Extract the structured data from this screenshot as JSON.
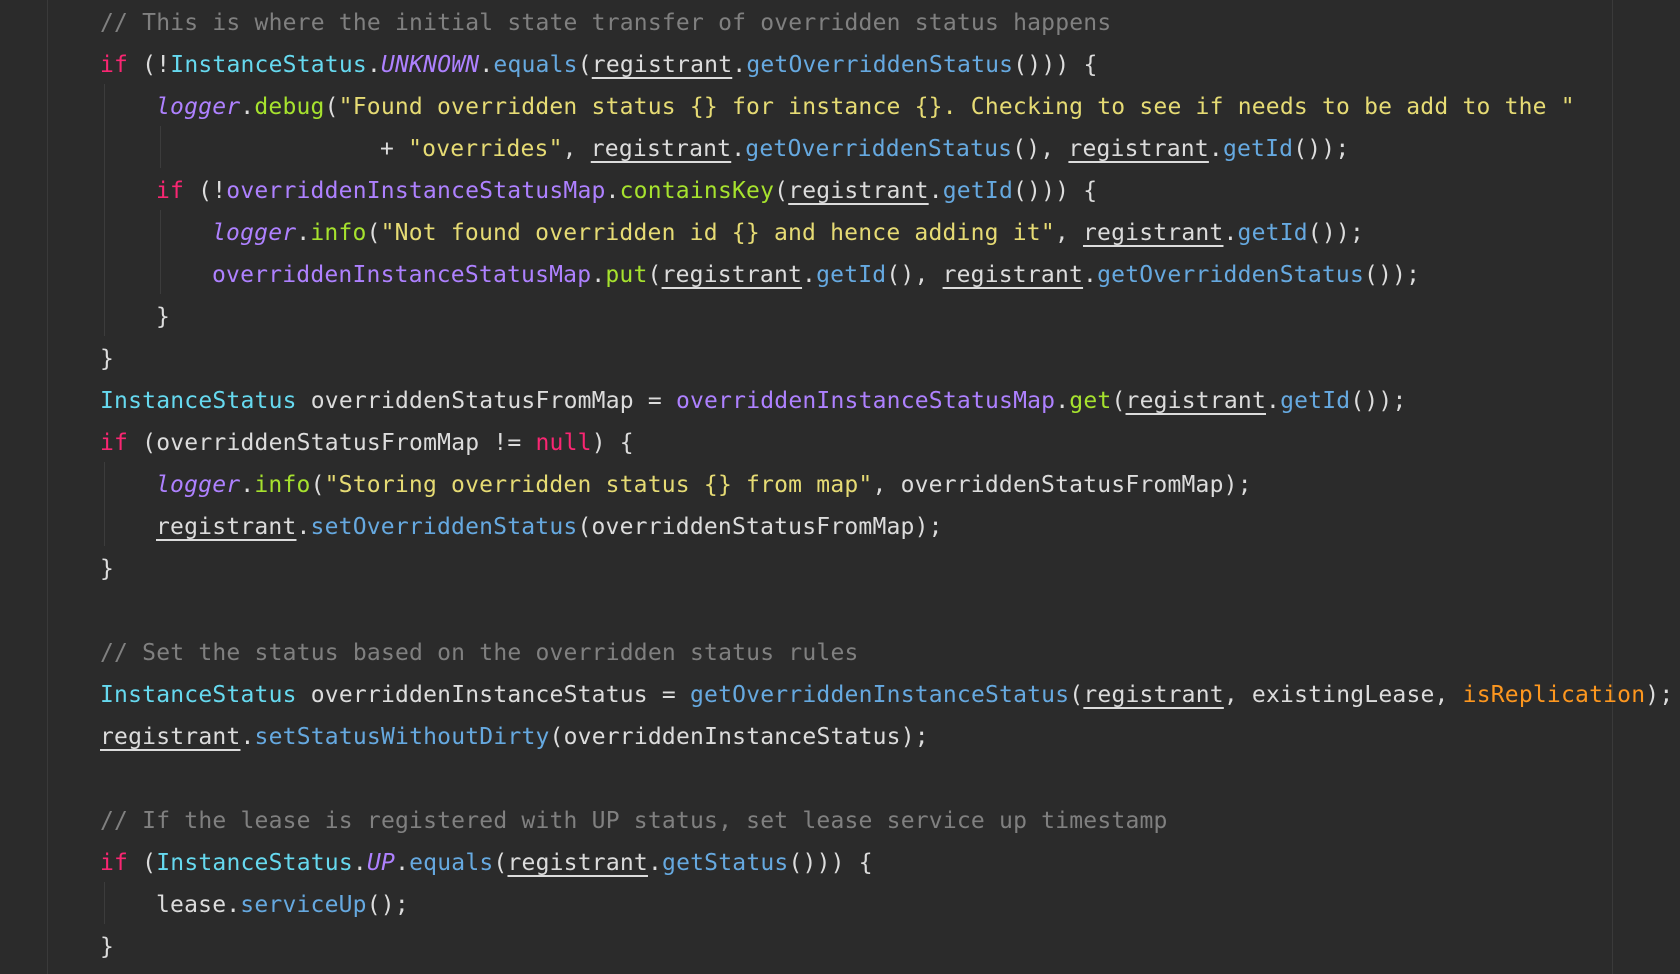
{
  "editor": {
    "lines": [
      [
        {
          "t": "// This is where the initial state transfer of overridden status happens",
          "c": "comment"
        }
      ],
      [
        {
          "t": "if",
          "c": "keyword"
        },
        {
          "t": " (!",
          "c": "plain"
        },
        {
          "t": "InstanceStatus",
          "c": "type"
        },
        {
          "t": ".",
          "c": "plain"
        },
        {
          "t": "UNKNOWN",
          "c": "const"
        },
        {
          "t": ".",
          "c": "plain"
        },
        {
          "t": "equals",
          "c": "method"
        },
        {
          "t": "(",
          "c": "plain"
        },
        {
          "t": "registrant",
          "c": "plain",
          "u": true
        },
        {
          "t": ".",
          "c": "plain"
        },
        {
          "t": "getOverriddenStatus",
          "c": "method"
        },
        {
          "t": "())) {",
          "c": "plain"
        }
      ],
      [
        {
          "t": "logger",
          "c": "logger"
        },
        {
          "t": ".",
          "c": "plain"
        },
        {
          "t": "debug",
          "c": "call-green"
        },
        {
          "t": "(",
          "c": "plain"
        },
        {
          "t": "\"Found overridden status {} for instance {}. Checking to see if needs to be add to the \"",
          "c": "string"
        }
      ],
      [
        {
          "t": "+ ",
          "c": "plain"
        },
        {
          "t": "\"overrides\"",
          "c": "string"
        },
        {
          "t": ", ",
          "c": "plain"
        },
        {
          "t": "registrant",
          "c": "plain",
          "u": true
        },
        {
          "t": ".",
          "c": "plain"
        },
        {
          "t": "getOverriddenStatus",
          "c": "method"
        },
        {
          "t": "(), ",
          "c": "plain"
        },
        {
          "t": "registrant",
          "c": "plain",
          "u": true
        },
        {
          "t": ".",
          "c": "plain"
        },
        {
          "t": "getId",
          "c": "method"
        },
        {
          "t": "());",
          "c": "plain"
        }
      ],
      [
        {
          "t": "if",
          "c": "keyword"
        },
        {
          "t": " (!",
          "c": "plain"
        },
        {
          "t": "overriddenInstanceStatusMap",
          "c": "field"
        },
        {
          "t": ".",
          "c": "plain"
        },
        {
          "t": "containsKey",
          "c": "call-green"
        },
        {
          "t": "(",
          "c": "plain"
        },
        {
          "t": "registrant",
          "c": "plain",
          "u": true
        },
        {
          "t": ".",
          "c": "plain"
        },
        {
          "t": "getId",
          "c": "method"
        },
        {
          "t": "())) {",
          "c": "plain"
        }
      ],
      [
        {
          "t": "logger",
          "c": "logger"
        },
        {
          "t": ".",
          "c": "plain"
        },
        {
          "t": "info",
          "c": "call-green"
        },
        {
          "t": "(",
          "c": "plain"
        },
        {
          "t": "\"Not found overridden id {} and hence adding it\"",
          "c": "string"
        },
        {
          "t": ", ",
          "c": "plain"
        },
        {
          "t": "registrant",
          "c": "plain",
          "u": true
        },
        {
          "t": ".",
          "c": "plain"
        },
        {
          "t": "getId",
          "c": "method"
        },
        {
          "t": "());",
          "c": "plain"
        }
      ],
      [
        {
          "t": "overriddenInstanceStatusMap",
          "c": "field"
        },
        {
          "t": ".",
          "c": "plain"
        },
        {
          "t": "put",
          "c": "call-green"
        },
        {
          "t": "(",
          "c": "plain"
        },
        {
          "t": "registrant",
          "c": "plain",
          "u": true
        },
        {
          "t": ".",
          "c": "plain"
        },
        {
          "t": "getId",
          "c": "method"
        },
        {
          "t": "(), ",
          "c": "plain"
        },
        {
          "t": "registrant",
          "c": "plain",
          "u": true
        },
        {
          "t": ".",
          "c": "plain"
        },
        {
          "t": "getOverriddenStatus",
          "c": "method"
        },
        {
          "t": "());",
          "c": "plain"
        }
      ],
      [
        {
          "t": "}",
          "c": "plain"
        }
      ],
      [
        {
          "t": "}",
          "c": "plain"
        }
      ],
      [
        {
          "t": "InstanceStatus",
          "c": "type"
        },
        {
          "t": " overriddenStatusFromMap = ",
          "c": "plain"
        },
        {
          "t": "overriddenInstanceStatusMap",
          "c": "field"
        },
        {
          "t": ".",
          "c": "plain"
        },
        {
          "t": "get",
          "c": "call-green"
        },
        {
          "t": "(",
          "c": "plain"
        },
        {
          "t": "registrant",
          "c": "plain",
          "u": true
        },
        {
          "t": ".",
          "c": "plain"
        },
        {
          "t": "getId",
          "c": "method"
        },
        {
          "t": "());",
          "c": "plain"
        }
      ],
      [
        {
          "t": "if",
          "c": "keyword"
        },
        {
          "t": " (overriddenStatusFromMap != ",
          "c": "plain"
        },
        {
          "t": "null",
          "c": "keyword"
        },
        {
          "t": ") {",
          "c": "plain"
        }
      ],
      [
        {
          "t": "logger",
          "c": "logger"
        },
        {
          "t": ".",
          "c": "plain"
        },
        {
          "t": "info",
          "c": "call-green"
        },
        {
          "t": "(",
          "c": "plain"
        },
        {
          "t": "\"Storing overridden status {} from map\"",
          "c": "string"
        },
        {
          "t": ", overriddenStatusFromMap);",
          "c": "plain"
        }
      ],
      [
        {
          "t": "registrant",
          "c": "plain",
          "u": true
        },
        {
          "t": ".",
          "c": "plain"
        },
        {
          "t": "setOverriddenStatus",
          "c": "method"
        },
        {
          "t": "(overriddenStatusFromMap);",
          "c": "plain"
        }
      ],
      [
        {
          "t": "}",
          "c": "plain"
        }
      ],
      [],
      [
        {
          "t": "// Set the status based on the overridden status rules",
          "c": "comment"
        }
      ],
      [
        {
          "t": "InstanceStatus",
          "c": "type"
        },
        {
          "t": " overriddenInstanceStatus = ",
          "c": "plain"
        },
        {
          "t": "getOverriddenInstanceStatus",
          "c": "method"
        },
        {
          "t": "(",
          "c": "plain"
        },
        {
          "t": "registrant",
          "c": "plain",
          "u": true
        },
        {
          "t": ", existingLease, ",
          "c": "plain"
        },
        {
          "t": "isReplication",
          "c": "param"
        },
        {
          "t": ");",
          "c": "plain"
        }
      ],
      [
        {
          "t": "registrant",
          "c": "plain",
          "u": true
        },
        {
          "t": ".",
          "c": "plain"
        },
        {
          "t": "setStatusWithoutDirty",
          "c": "method"
        },
        {
          "t": "(overriddenInstanceStatus);",
          "c": "plain"
        }
      ],
      [],
      [
        {
          "t": "// If the lease is registered with UP status, set lease service up timestamp",
          "c": "comment"
        }
      ],
      [
        {
          "t": "if",
          "c": "keyword"
        },
        {
          "t": " (",
          "c": "plain"
        },
        {
          "t": "InstanceStatus",
          "c": "type"
        },
        {
          "t": ".",
          "c": "plain"
        },
        {
          "t": "UP",
          "c": "const"
        },
        {
          "t": ".",
          "c": "plain"
        },
        {
          "t": "equals",
          "c": "method"
        },
        {
          "t": "(",
          "c": "plain"
        },
        {
          "t": "registrant",
          "c": "plain",
          "u": true
        },
        {
          "t": ".",
          "c": "plain"
        },
        {
          "t": "getStatus",
          "c": "method"
        },
        {
          "t": "())) {",
          "c": "plain"
        }
      ],
      [
        {
          "t": "lease.",
          "c": "plain"
        },
        {
          "t": "serviceUp",
          "c": "method"
        },
        {
          "t": "();",
          "c": "plain"
        }
      ],
      [
        {
          "t": "}",
          "c": "plain"
        }
      ]
    ]
  }
}
